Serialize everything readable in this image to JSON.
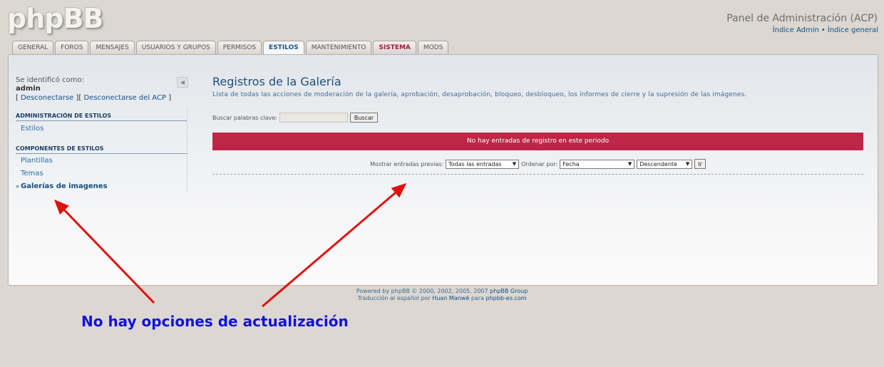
{
  "header": {
    "logo": "phpBB",
    "title": "Panel de Administración (ACP)",
    "links": [
      "Índice Admin",
      "Índice general"
    ],
    "link_separator": "•"
  },
  "tabs": [
    {
      "label": "GENERAL",
      "active": false
    },
    {
      "label": "FOROS",
      "active": false
    },
    {
      "label": "MENSAJES",
      "active": false
    },
    {
      "label": "USUARIOS Y GRUPOS",
      "active": false
    },
    {
      "label": "PERMISOS",
      "active": false
    },
    {
      "label": "ESTILOS",
      "active": true
    },
    {
      "label": "MANTENIMIENTO",
      "active": false
    },
    {
      "label": "SISTEMA",
      "active": false,
      "color": "#a8193a"
    },
    {
      "label": "MODS",
      "active": false
    }
  ],
  "sidebar": {
    "identified_as": "Se identificó como:",
    "username": "admin",
    "logout": {
      "open_bracket": "[",
      "logout_link": "Desconectarse",
      "mid": "][",
      "logout_acp_link": "Desconectarse del ACP",
      "close_bracket": "]"
    },
    "collapse_icon": "arrow-left-icon",
    "sections": [
      {
        "heading": "ADMINISTRACIÓN DE ESTILOS",
        "items": [
          "Estilos"
        ]
      },
      {
        "heading": "COMPONENTES DE ESTILOS",
        "items": [
          "Plantillas",
          "Temas",
          "Galerías de imagenes"
        ]
      }
    ],
    "current_item": "Galerías de imagenes",
    "current_marker": "»"
  },
  "main": {
    "title": "Registros de la Galería",
    "description": "Lista de todas las acciones de moderación de la galería, aprobación, desaprobación, bloqueo, desbloqueo, los informes de cierre y la supresión de las imágenes.",
    "search_label": "Buscar palabras clave:",
    "search_value": "",
    "search_button": "Buscar",
    "error_message": "No hay entradas de registro en este periodo",
    "error_color": "#bd2646",
    "filters": {
      "show_label": "Mostrar entradas previas:",
      "show_value": "Todas las entradas",
      "order_label": "Ordenar por:",
      "order_value": "Fecha",
      "direction_value": "Descendente",
      "go_button": "Ir"
    }
  },
  "footer": {
    "line1_prefix": "Powered by phpBB © 2000, 2002, 2005, 2007",
    "line1_link": "phpBB Group",
    "line2_prefix": "Traducción al español por",
    "line2_author": "Huan Manwë",
    "line2_mid": "para",
    "line2_site": "phpbb-es.com"
  },
  "annotation": {
    "text": "No hay opciones de actualización",
    "text_color": "#1111dd",
    "arrow_color": "#e01010"
  }
}
